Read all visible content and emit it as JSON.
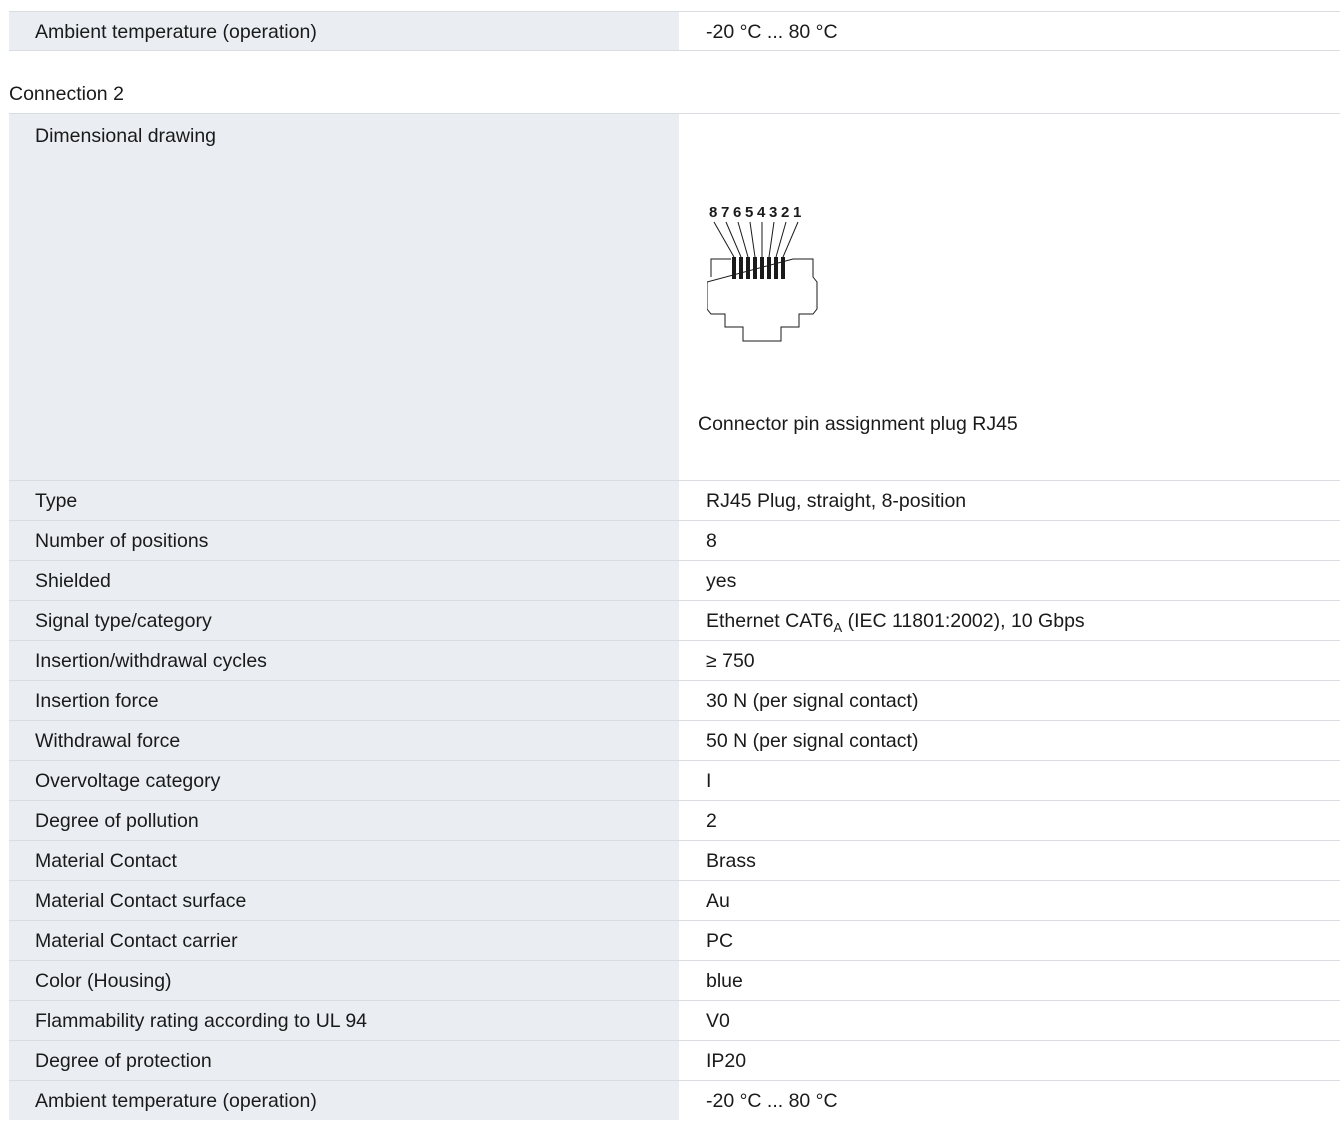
{
  "top_row": {
    "label": "Ambient temperature (operation)",
    "value": "-20 °C ... 80 °C"
  },
  "section_title": "Connection 2",
  "drawing_row": {
    "label": "Dimensional drawing",
    "pin_labels": [
      "8",
      "7",
      "6",
      "5",
      "4",
      "3",
      "2",
      "1"
    ],
    "caption": "Connector pin assignment plug RJ45"
  },
  "rows": [
    {
      "label": "Type",
      "value": "RJ45 Plug, straight, 8-position"
    },
    {
      "label": "Number of positions",
      "value": "8"
    },
    {
      "label": "Shielded",
      "value": "yes"
    },
    {
      "label": "Signal type/category",
      "value_pre": "Ethernet CAT6",
      "value_sub": "A",
      "value_post": " (IEC 11801:2002), 10 Gbps"
    },
    {
      "label": "Insertion/withdrawal cycles",
      "value": "≥ 750"
    },
    {
      "label": "Insertion force",
      "value": "30 N (per signal contact)"
    },
    {
      "label": "Withdrawal force",
      "value": "50 N (per signal contact)"
    },
    {
      "label": "Overvoltage category",
      "value": "I"
    },
    {
      "label": "Degree of pollution",
      "value": "2"
    },
    {
      "label": "Material Contact",
      "value": "Brass"
    },
    {
      "label": "Material Contact surface",
      "value": "Au"
    },
    {
      "label": "Material Contact carrier",
      "value": "PC"
    },
    {
      "label": "Color (Housing)",
      "value": "blue"
    },
    {
      "label": "Flammability rating according to UL 94",
      "value": "V0"
    },
    {
      "label": "Degree of protection",
      "value": "IP20"
    },
    {
      "label": "Ambient temperature (operation)",
      "value": "-20 °C ... 80 °C"
    }
  ]
}
